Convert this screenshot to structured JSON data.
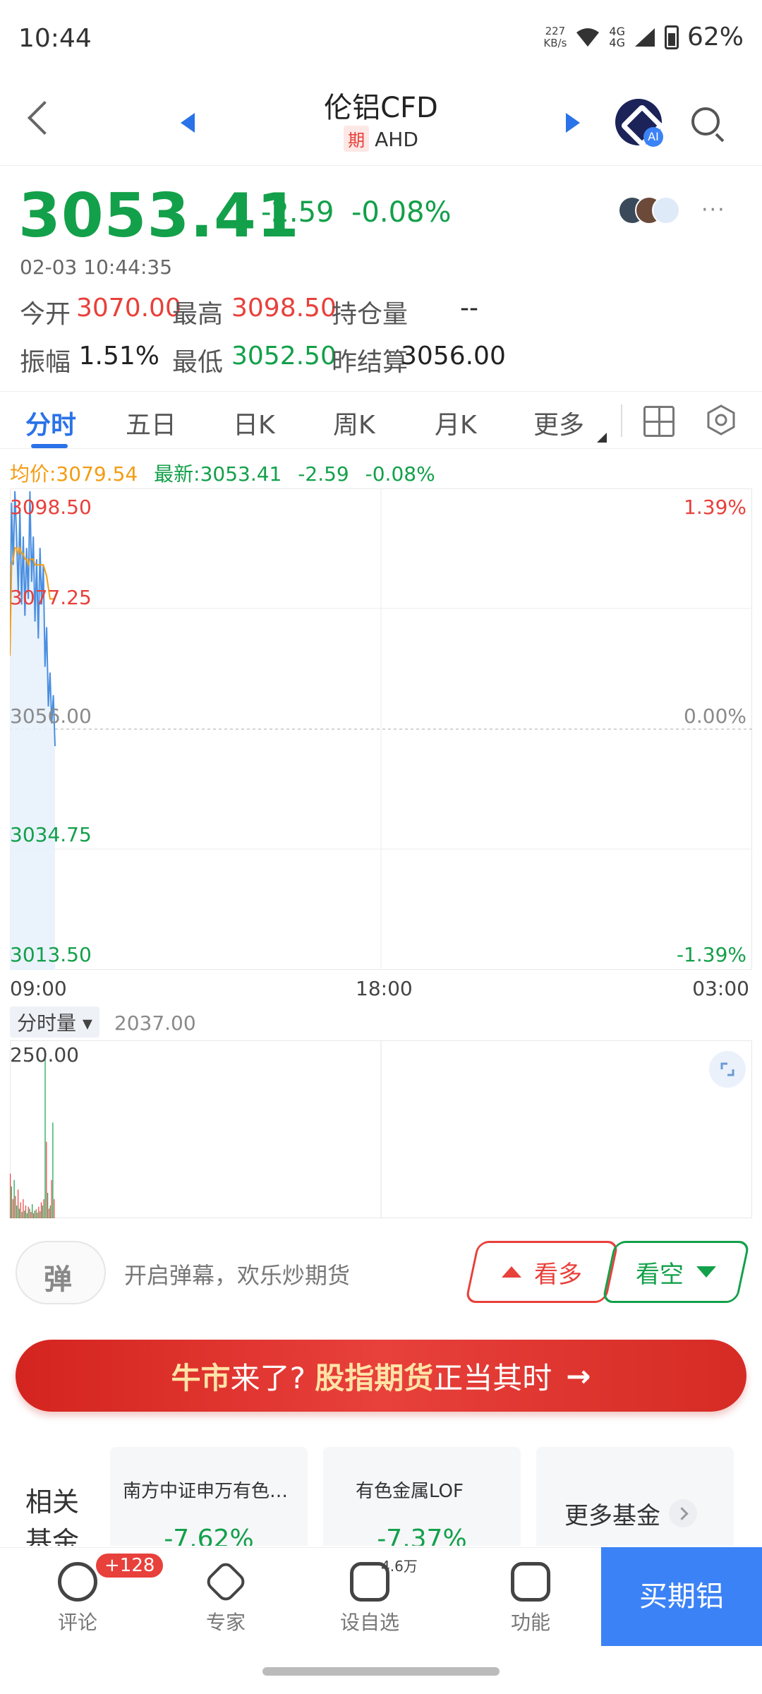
{
  "status_bar": {
    "time": "10:44",
    "net_speed": "227",
    "net_unit": "KB/s",
    "battery": "62%",
    "net_type": "4G"
  },
  "header": {
    "title": "伦铝CFD",
    "tag": "期",
    "code": "AHD"
  },
  "quote": {
    "price": "3053.41",
    "change": "-2.59",
    "change_pct": "-0.08%",
    "time": "02-03 10:44:35",
    "stats": {
      "open_label": "今开",
      "open": "3070.00",
      "high_label": "最高",
      "high": "3098.50",
      "oi_label": "持仓量",
      "oi": "--",
      "amp_label": "振幅",
      "amp": "1.51%",
      "low_label": "最低",
      "low": "3052.50",
      "settle_label": "昨结算",
      "settle": "3056.00"
    }
  },
  "tabs": [
    "分时",
    "五日",
    "日K",
    "周K",
    "月K",
    "更多"
  ],
  "legend": {
    "avg": "均价:3079.54",
    "latest": "最新:3053.41",
    "chg": "-2.59",
    "pct": "-0.08%"
  },
  "chart_data": [
    {
      "type": "line",
      "title": "",
      "series": [
        {
          "values": [
            3069,
            3096,
            3085,
            3098,
            3090,
            3080,
            3095,
            3078,
            3090,
            3076,
            3088,
            3079,
            3098,
            3082,
            3090,
            3075,
            3086,
            3072,
            3088,
            3078,
            3085,
            3067,
            3074,
            3060,
            3066,
            3057,
            3062,
            3053
          ]
        },
        {
          "values": [
            3069,
            3085,
            3086,
            3088,
            3088,
            3087,
            3088,
            3087,
            3087,
            3086,
            3086,
            3085,
            3086,
            3086,
            3086,
            3085,
            3085,
            3085,
            3085,
            3085,
            3085,
            3084,
            3083,
            3081,
            3079,
            3079,
            3079,
            3079
          ]
        }
      ],
      "ylim": [
        3013.5,
        3098.5
      ],
      "ytick_labels": [
        "3098.50",
        "3077.25",
        "3056.00",
        "3034.75",
        "3013.50"
      ],
      "ytick_right": [
        "1.39%",
        "0.00%",
        "-1.39%"
      ],
      "xtick_labels": [
        "09:00",
        "18:00",
        "03:00"
      ],
      "reference": 3056.0
    },
    {
      "type": "bar",
      "title": "分时量",
      "current": "2037.00",
      "ymax_label": "250.00",
      "values": [
        70,
        50,
        30,
        60,
        35,
        20,
        45,
        15,
        25,
        10,
        30,
        12,
        20,
        8,
        18,
        15,
        10,
        22,
        8,
        12,
        14,
        9,
        18,
        11,
        25,
        20,
        30,
        260,
        120,
        40,
        15,
        20,
        60,
        150,
        30
      ],
      "colors": [
        "r",
        "g",
        "r",
        "g",
        "r",
        "g",
        "r",
        "g",
        "r",
        "g",
        "r",
        "g",
        "r",
        "g",
        "r",
        "g",
        "r",
        "g",
        "r",
        "g",
        "r",
        "g",
        "r",
        "g",
        "r",
        "g",
        "r",
        "g",
        "r",
        "g",
        "r",
        "g",
        "r",
        "g",
        "r"
      ]
    }
  ],
  "danmaku": {
    "icon_text": "弹",
    "placeholder": "开启弹幕，欢乐炒期货"
  },
  "trade_buttons": {
    "long": "看多",
    "short": "看空"
  },
  "banner": {
    "part1": "牛市",
    "part2": "来了?",
    "part3": "股指期货",
    "part4": "正当其时"
  },
  "related": {
    "label_line1": "相关",
    "label_line2": "基金",
    "funds": [
      {
        "name": "南方中证申万有色金属...",
        "change": "-7.62%"
      },
      {
        "name": "有色金属LOF",
        "change": "-7.37%"
      }
    ],
    "more": "更多基金"
  },
  "bottom_bar": {
    "comment": "评论",
    "comment_badge": "+128",
    "expert": "专家",
    "watch": "设自选",
    "watch_count": "4.6万",
    "func": "功能",
    "buy": "买期铝"
  },
  "colors": {
    "up": "#e8403b",
    "down": "#13a04a",
    "accent": "#2a72e8",
    "avg_line": "#f39c12"
  }
}
